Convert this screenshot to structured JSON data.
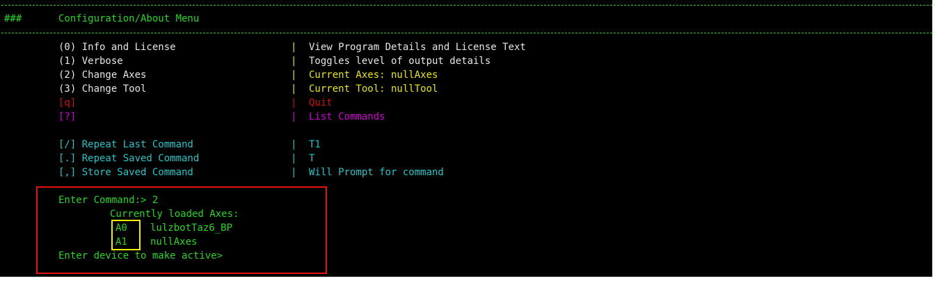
{
  "header": {
    "hashes": "###",
    "title": "Configuration/About Menu"
  },
  "menu": {
    "items": [
      {
        "key": "(0) Info and License",
        "sep": "|",
        "desc": "View Program Details and License Text"
      },
      {
        "key": "(1) Verbose",
        "sep": "|",
        "desc": "Toggles level of output details"
      },
      {
        "key": "(2) Change Axes",
        "sep": "|",
        "desc": "Current Axes: nullAxes"
      },
      {
        "key": "(3) Change Tool",
        "sep": "|",
        "desc": "Current Tool: nullTool"
      },
      {
        "key": "[q]",
        "sep": "|",
        "desc": "Quit"
      },
      {
        "key": "[?]",
        "sep": "|",
        "desc": "List Commands"
      }
    ],
    "saved": [
      {
        "key": "[/] Repeat Last Command",
        "sep": "|",
        "desc": "T1"
      },
      {
        "key": "[.] Repeat Saved Command",
        "sep": "|",
        "desc": "T"
      },
      {
        "key": "[,] Store Saved Command",
        "sep": "|",
        "desc": "Will Prompt for command"
      }
    ]
  },
  "session": {
    "prompt": "Enter Command:> 2",
    "loaded_heading": "Currently loaded Axes:",
    "axes": [
      {
        "id": "A0",
        "name": "lulzbotTaz6_BP"
      },
      {
        "id": "A1",
        "name": "nullAxes"
      }
    ],
    "device_prompt": "Enter device to make active>"
  },
  "colors": {
    "background": "#000000",
    "green": "#22d822",
    "yellow": "#e8e800",
    "red": "#d01010",
    "magenta": "#d000d0",
    "cyan": "#1cc8c8",
    "highlight_red": "#e51212",
    "highlight_yellow": "#f0f000"
  }
}
